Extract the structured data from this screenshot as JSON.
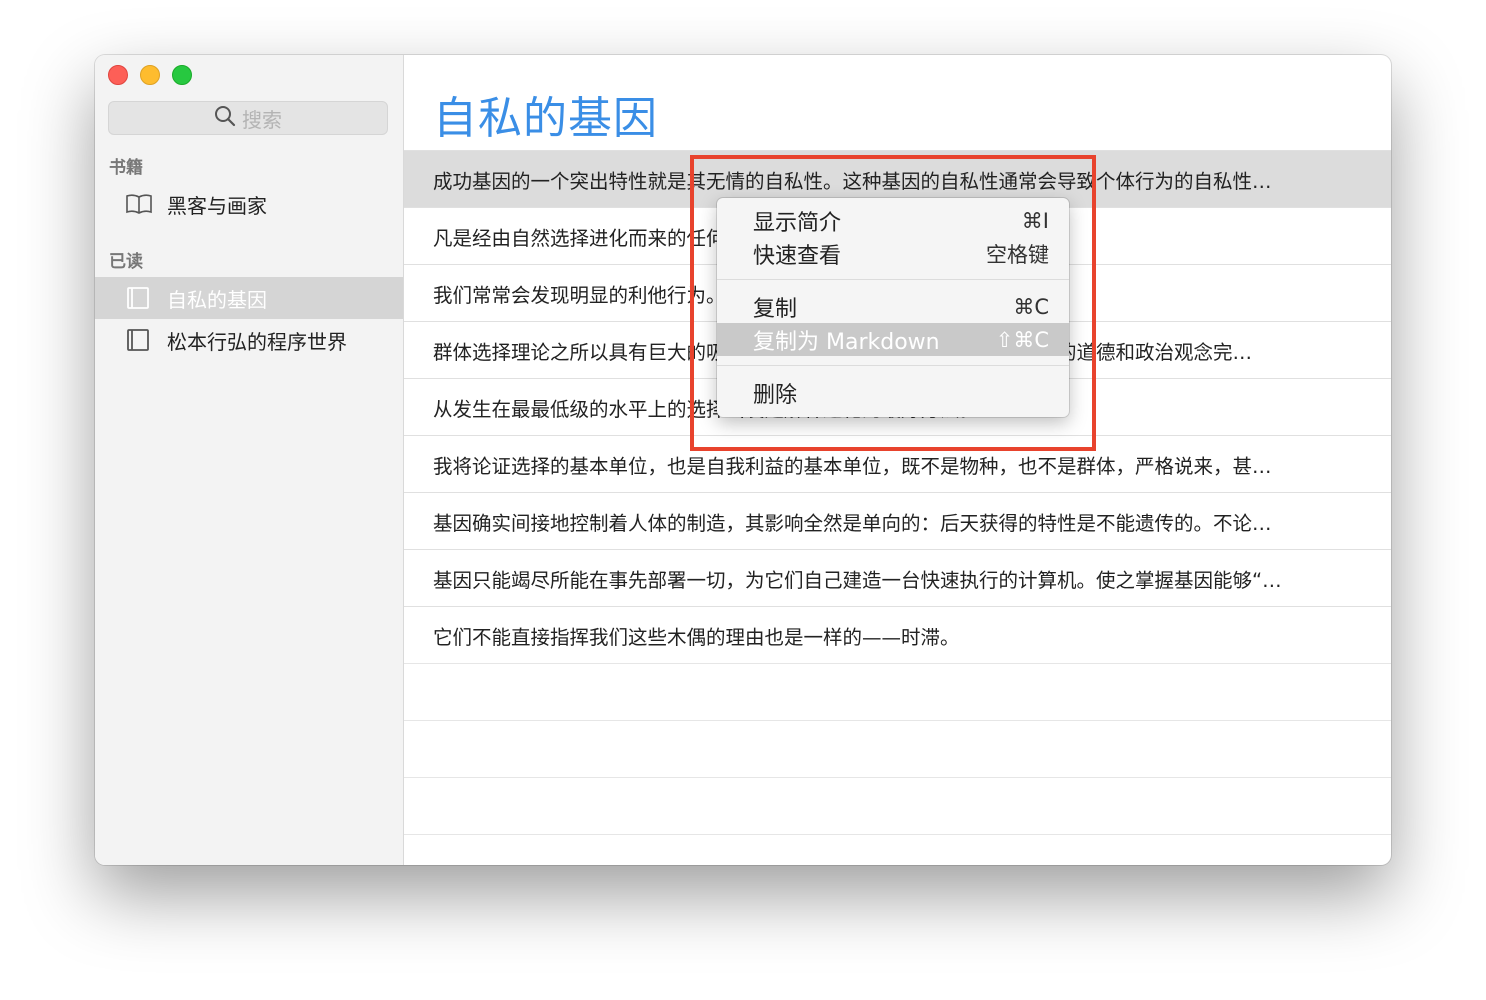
{
  "sidebar": {
    "search_placeholder": "搜索",
    "section_books": "书籍",
    "books": [
      {
        "label": "黑客与画家"
      }
    ],
    "section_read": "已读",
    "read": [
      {
        "label": "自私的基因",
        "selected": true
      },
      {
        "label": "松本行弘的程序世界",
        "selected": false
      }
    ]
  },
  "main": {
    "title": "自私的基因",
    "rows": [
      "成功基因的一个突出特性就是其无情的自私性。这种基因的自私性通常会导致个体行为的自私性…",
      "凡是经由自然选择进化而来的任何东西应该是自私的。",
      "我们常常会发现明显的利他行为。",
      "群体选择理论之所以具有巨大的吸引力，其原因之一是它同我们大部分人的道德和政治观念完…",
      "从发生在最最低级的水平上的选择出发是解释进化的最好方法。",
      "我将论证选择的基本单位，也是自我利益的基本单位，既不是物种，也不是群体，严格说来，甚…",
      "基因确实间接地控制着人体的制造，其影响全然是单向的：后天获得的特性是不能遗传的。不论…",
      "基因只能竭尽所能在事先部署一切，为它们自己建造一台快速执行的计算机。使之掌握基因能够“…",
      "它们不能直接指挥我们这些木偶的理由也是一样的——时滞。"
    ]
  },
  "context_menu": {
    "items": [
      {
        "label": "显示简介",
        "shortcut": "⌘I"
      },
      {
        "label": "快速查看",
        "shortcut": "空格键"
      },
      {
        "label": "复制",
        "shortcut": "⌘C"
      },
      {
        "label": "复制为 Markdown",
        "shortcut": "⇧⌘C"
      },
      {
        "label": "删除",
        "shortcut": ""
      }
    ],
    "active_index": 3
  },
  "colors": {
    "title": "#3a8ee6",
    "highlight_box": "#e8432d"
  }
}
